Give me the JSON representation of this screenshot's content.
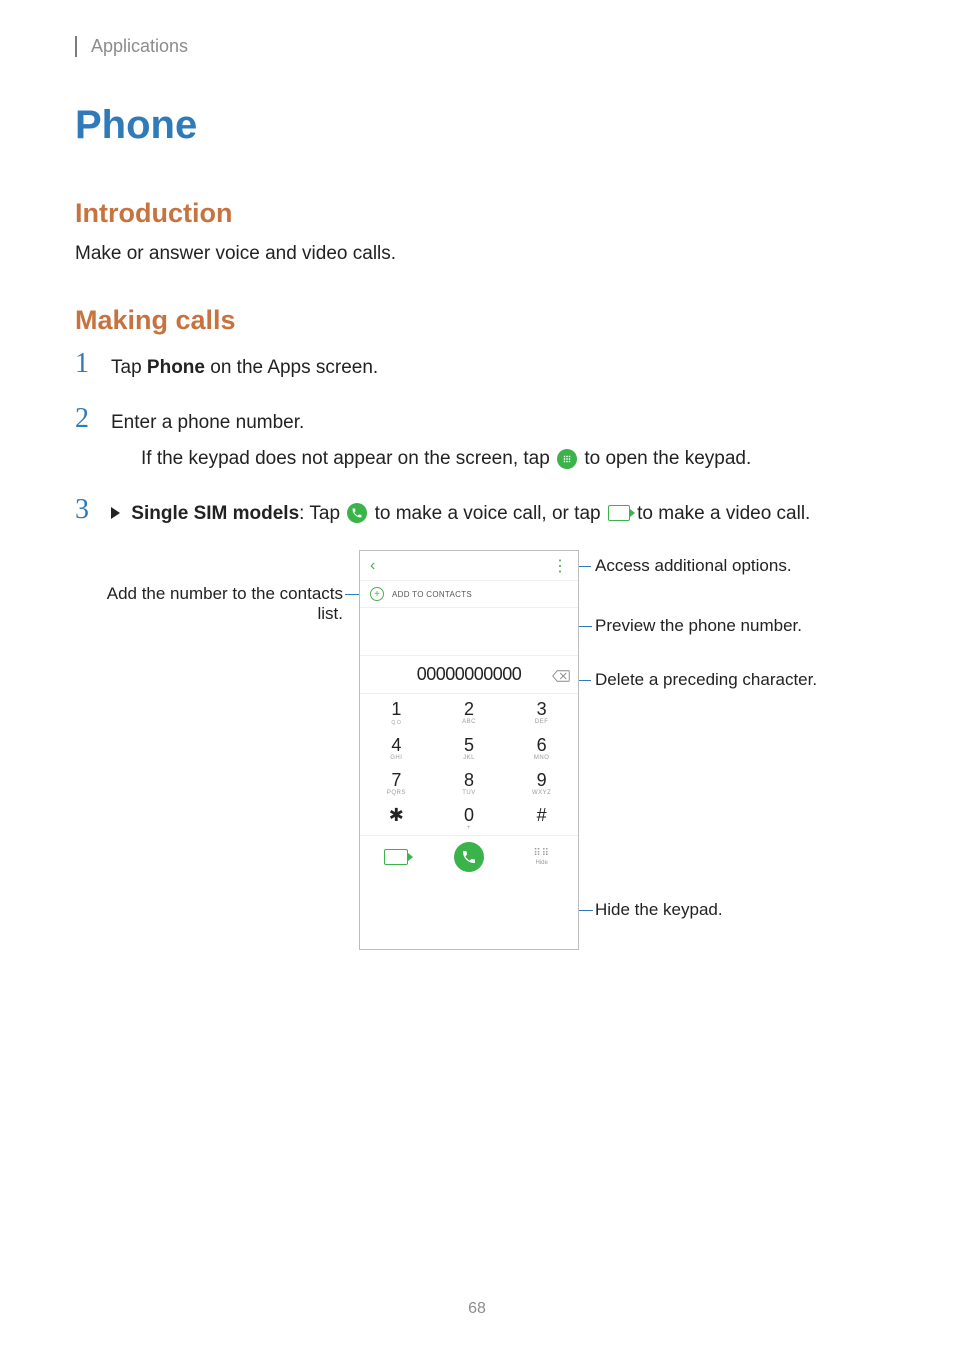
{
  "breadcrumb": "Applications",
  "title": "Phone",
  "section_intro_heading": "Introduction",
  "intro_text": "Make or answer voice and video calls.",
  "section_making_heading": "Making calls",
  "steps": {
    "s1": {
      "num": "1",
      "text_a": "Tap ",
      "bold": "Phone",
      "text_b": " on the Apps screen."
    },
    "s2": {
      "num": "2",
      "line1": "Enter a phone number.",
      "line2a": "If the keypad does not appear on the screen, tap ",
      "line2b": " to open the keypad."
    },
    "s3": {
      "num": "3",
      "bold": "Single SIM models",
      "text_a": ": Tap ",
      "text_b": " to make a voice call, or tap ",
      "text_c": " to make a video call."
    }
  },
  "phone_ui": {
    "add_to_contacts": "ADD TO CONTACTS",
    "number": "00000000000",
    "keys": [
      {
        "d": "1",
        "l": ""
      },
      {
        "d": "2",
        "l": "ABC"
      },
      {
        "d": "3",
        "l": "DEF"
      },
      {
        "d": "4",
        "l": "GHI"
      },
      {
        "d": "5",
        "l": "JKL"
      },
      {
        "d": "6",
        "l": "MNO"
      },
      {
        "d": "7",
        "l": "PQRS"
      },
      {
        "d": "8",
        "l": "TUV"
      },
      {
        "d": "9",
        "l": "WXYZ"
      },
      {
        "d": "✱",
        "l": ""
      },
      {
        "d": "0",
        "l": "+"
      },
      {
        "d": "#",
        "l": ""
      }
    ],
    "hide_label": "Hide"
  },
  "callouts": {
    "add_contacts": "Add the number to the contacts list.",
    "more_options": "Access additional options.",
    "preview": "Preview the phone number.",
    "delete": "Delete a preceding character.",
    "hide": "Hide the keypad."
  },
  "page_number": "68",
  "glyphs": {
    "voicemail": "ＱＯ"
  }
}
